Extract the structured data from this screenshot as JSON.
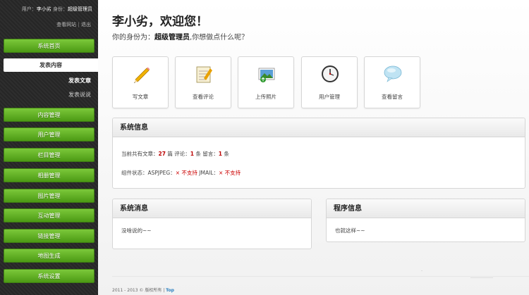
{
  "sidebar": {
    "user_prefix": "用户：",
    "user_name": "李小劣",
    "role_prefix": " 身份：",
    "role": "超级管理员",
    "link_view_site": "查看网站",
    "link_sep": "|",
    "link_logout": "退出",
    "nav": {
      "home": "系统首页",
      "publish": "发表内容",
      "sub_article": "发表文章",
      "sub_talk": "发表说说",
      "content": "内容管理",
      "users": "用户管理",
      "columns": "栏目管理",
      "album": "相册管理",
      "images": "图片管理",
      "interact": "互动管理",
      "links": "链接管理",
      "sitemap": "地图生成",
      "settings": "系统设置"
    }
  },
  "main": {
    "welcome": "李小劣，欢迎您！",
    "role_prefix": "你的身份为：",
    "role_name": "超级管理员",
    "role_suffix": ",你想做点什么呢？",
    "shortcuts": [
      {
        "label": "写文章",
        "icon": "pencil-icon"
      },
      {
        "label": "查看评论",
        "icon": "notepad-icon"
      },
      {
        "label": "上传照片",
        "icon": "photo-upload-icon"
      },
      {
        "label": "用户管理",
        "icon": "clock-icon"
      },
      {
        "label": "查看留言",
        "icon": "speech-bubble-icon"
      }
    ],
    "sysinfo": {
      "title": "系统信息",
      "stat_prefix": "当前共有文章：",
      "articles": "27",
      "unit_article": " 篇 评论：",
      "comments": "1",
      "unit_comment": " 条 留言：",
      "messages": "1",
      "unit_message": " 条",
      "component_prefix": "组件状态：ASPJPEG：",
      "aspjpeg_status": "× 不支持",
      "jmail_label": " JMAIL：",
      "jmail_status": "× 不支持"
    },
    "sysmsg": {
      "title": "系统消息",
      "body": "没啥说的~~"
    },
    "proginfo": {
      "title": "程序信息",
      "body": "也就这样~~"
    },
    "footer": {
      "copyright": "2011 - 2013 © 版权所有 | ",
      "top": "Top"
    }
  },
  "colors": {
    "nav_green": "#5aab1f",
    "error_red": "#cc0000",
    "sidebar_bg": "#2b2b2b"
  }
}
